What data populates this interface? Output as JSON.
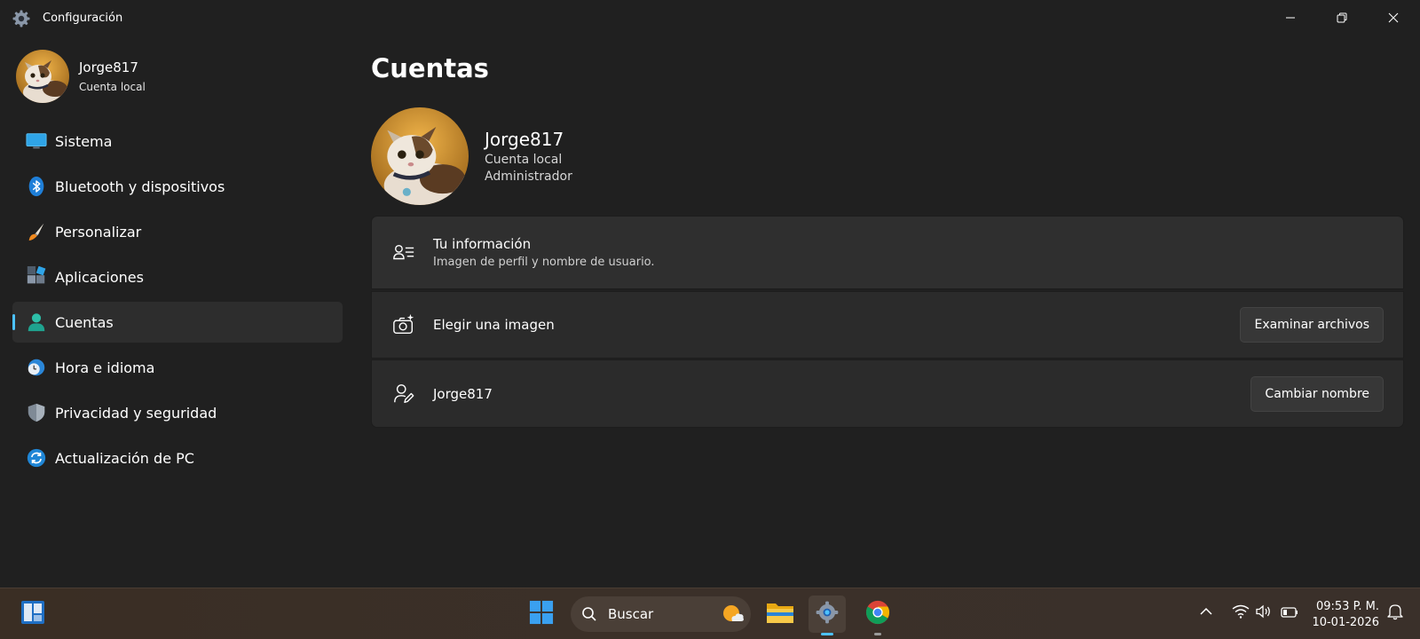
{
  "window": {
    "title": "Configuración",
    "icon": "gear-icon",
    "controls": [
      "minimize-icon",
      "restore-icon",
      "close-icon"
    ]
  },
  "sidebar": {
    "user": {
      "name": "Jorge817",
      "type": "Cuenta local"
    },
    "items": [
      {
        "label": "Sistema",
        "icon": "monitor-icon"
      },
      {
        "label": "Bluetooth y dispositivos",
        "icon": "bluetooth-icon"
      },
      {
        "label": "Personalizar",
        "icon": "brush-icon"
      },
      {
        "label": "Aplicaciones",
        "icon": "apps-icon"
      },
      {
        "label": "Cuentas",
        "icon": "person-icon",
        "active": true
      },
      {
        "label": "Hora e idioma",
        "icon": "clock-globe-icon"
      },
      {
        "label": "Privacidad y seguridad",
        "icon": "shield-icon"
      },
      {
        "label": "Actualización de PC",
        "icon": "update-icon"
      }
    ]
  },
  "main": {
    "title": "Cuentas",
    "account": {
      "name": "Jorge817",
      "type": "Cuenta local",
      "role": "Administrador"
    },
    "cards": {
      "info": {
        "title": "Tu información",
        "subtitle": "Imagen de perfil y nombre de usuario."
      },
      "picture": {
        "title": "Elegir una imagen",
        "button": "Examinar archivos"
      },
      "rename": {
        "title": "Jorge817",
        "button": "Cambiar nombre"
      }
    }
  },
  "taskbar": {
    "search_label": "Buscar",
    "clock_time": "09:53 P. M.",
    "clock_date": "10-01-2026",
    "accent": "#4cc2ff"
  }
}
